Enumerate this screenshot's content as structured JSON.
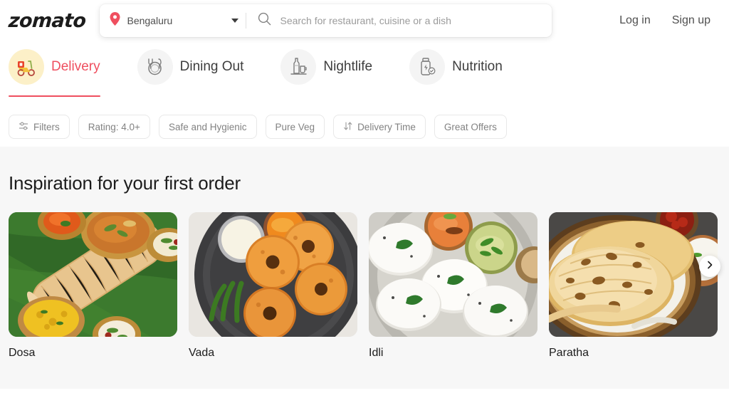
{
  "brand": {
    "logo_text": "zomato",
    "accent_color": "#ef4f5f"
  },
  "header": {
    "location": {
      "icon": "map-pin-icon",
      "value": "Bengaluru",
      "caret": "chevron-down-icon"
    },
    "search": {
      "icon": "search-icon",
      "placeholder": "Search for restaurant, cuisine or a dish",
      "value": ""
    },
    "auth": {
      "login_label": "Log in",
      "signup_label": "Sign up"
    }
  },
  "tabs": [
    {
      "label": "Delivery",
      "icon": "scooter-icon",
      "active": true
    },
    {
      "label": "Dining Out",
      "icon": "plate-cutlery-icon",
      "active": false
    },
    {
      "label": "Nightlife",
      "icon": "bottle-glass-icon",
      "active": false
    },
    {
      "label": "Nutrition",
      "icon": "supplement-bottle-icon",
      "active": false
    }
  ],
  "filters": [
    {
      "label": "Filters",
      "icon": "sliders-icon"
    },
    {
      "label": "Rating: 4.0+",
      "icon": ""
    },
    {
      "label": "Safe and Hygienic",
      "icon": ""
    },
    {
      "label": "Pure Veg",
      "icon": ""
    },
    {
      "label": "Delivery Time",
      "icon": "sort-arrows-icon"
    },
    {
      "label": "Great Offers",
      "icon": ""
    }
  ],
  "main": {
    "title": "Inspiration for your first order",
    "cards": [
      {
        "label": "Dosa"
      },
      {
        "label": "Vada"
      },
      {
        "label": "Idli"
      },
      {
        "label": "Paratha"
      }
    ],
    "next_button": "chevron-right-icon"
  }
}
